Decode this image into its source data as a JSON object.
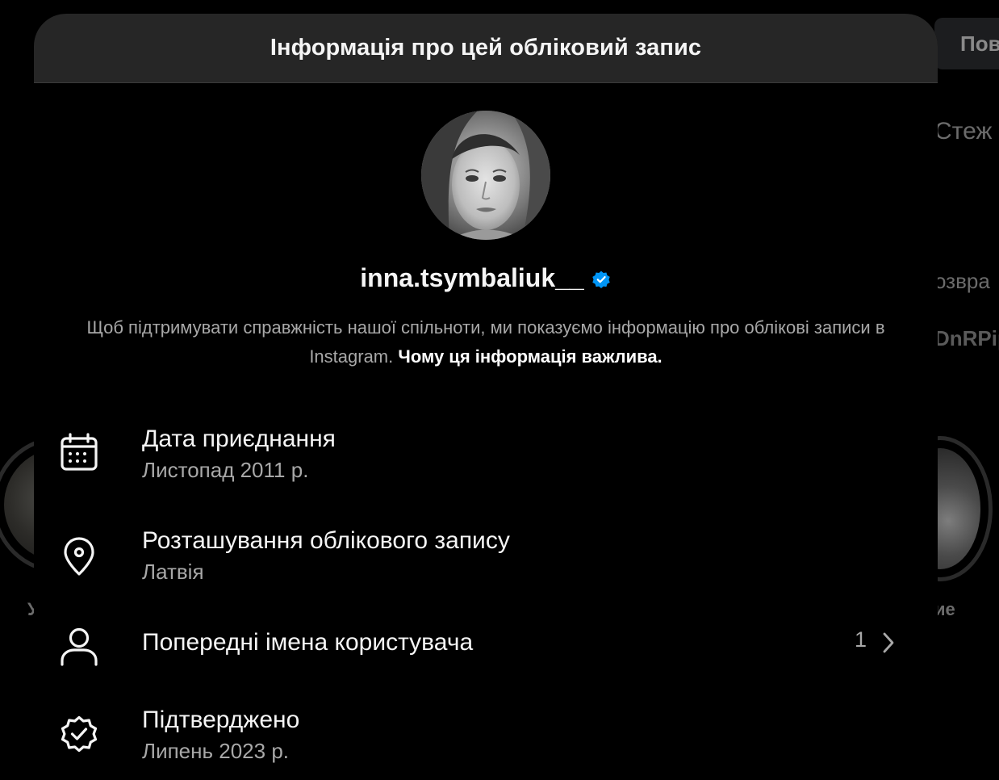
{
  "background": {
    "button_label": "Пов",
    "text_following": "Стеж",
    "text_return": "озвра",
    "text_code": "DnRPip",
    "caption_left": "У",
    "caption_right": "ие"
  },
  "modal": {
    "title": "Інформація про цей обліковий запис",
    "username": "inna.tsymbaliuk__",
    "verified_icon": "verified-badge-icon",
    "accent_color": "#0095f6",
    "notice_text": "Щоб підтримувати справжність нашої спільноти, ми показуємо інформацію про облікові записи в Instagram. ",
    "notice_link": "Чому ця інформація важлива."
  },
  "rows": [
    {
      "icon": "calendar-icon",
      "label": "Дата приєднання",
      "value": "Листопад 2011 р."
    },
    {
      "icon": "location-pin-icon",
      "label": "Розташування облікового запису",
      "value": "Латвія"
    },
    {
      "icon": "user-icon",
      "label": "Попередні імена користувача",
      "count": "1",
      "chevron": "chevron-right-icon"
    },
    {
      "icon": "verified-outline-icon",
      "label": "Підтверджено",
      "value": "Липень 2023 р."
    }
  ]
}
